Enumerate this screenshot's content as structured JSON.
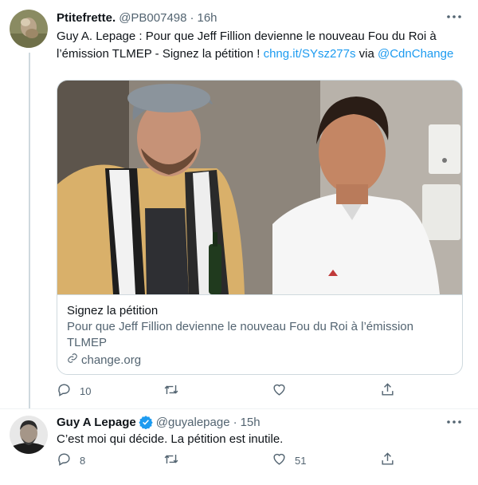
{
  "tweets": [
    {
      "name": "Ptitefrette.",
      "handle": "@PB007498",
      "dot": "·",
      "time": "16h",
      "text_before": "Guy A. Lepage : Pour que Jeff Fillion devienne le nouveau Fou du Roi à l’émission TLMEP - Signez la pétition ! ",
      "link1": "chng.it/SYsz277s",
      "text_mid": " via ",
      "link2": "@CdnChange",
      "card": {
        "title": "Signez la pétition",
        "description": "Pour que Jeff Fillion devienne le nouveau Fou du Roi à l’émission TLMEP",
        "domain": "change.org"
      },
      "replies": "10",
      "retweets": "",
      "likes": ""
    },
    {
      "name": "Guy A Lepage",
      "verified": true,
      "handle": "@guyalepage",
      "dot": "·",
      "time": "15h",
      "text": "C’est moi qui décide. La pétition est inutile.",
      "replies": "8",
      "retweets": "",
      "likes": "51"
    }
  ],
  "colors": {
    "link": "#1d9bf0",
    "secondary_text": "#536471",
    "border": "#cfd9de",
    "verified_badge": "#1d9bf0"
  },
  "icons": [
    "more-icon",
    "reply-icon",
    "retweet-icon",
    "like-icon",
    "share-icon",
    "verified-icon",
    "link-icon"
  ]
}
